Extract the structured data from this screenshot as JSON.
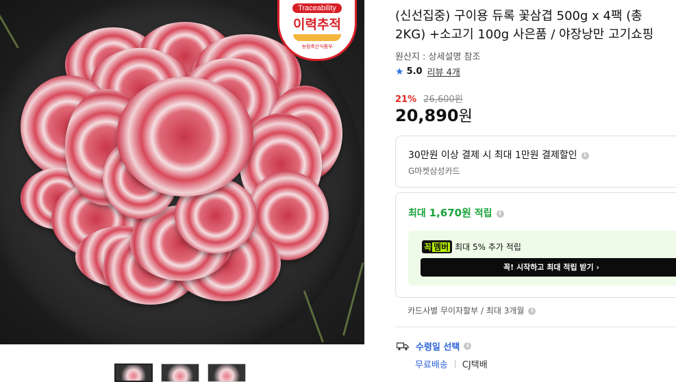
{
  "image": {
    "badge_top": "Traceability",
    "badge_main": "이력추적",
    "badge_bottom": "농림축산식품부"
  },
  "product": {
    "title": "(신선집중) 구이용 듀록 꽃삼겹 500g x 4팩 (총 2KG) +소고기 100g 사은품 / 야장낭만 고기쇼핑",
    "origin": "원산지 : 상세설명 참조",
    "rating": "5.0",
    "reviews": "리뷰 4개",
    "discount_rate": "21%",
    "original_price": "26,600원",
    "price_number": "20,890",
    "price_unit": "원"
  },
  "card_offer": {
    "title": "30만원 이상 결제 시 최대 1만원 결제할인",
    "card": "G마켓삼성카드"
  },
  "points": {
    "prefix": "최대",
    "amount": "1,670원",
    "suffix": "적립",
    "member_pill_a": "꼭",
    "member_pill_b": "멤버",
    "member_text": "최대 5% 추가 적립",
    "cta": "꼭! 시작하고 최대 적립 받기  ›"
  },
  "installment": "카드사별 무이자할부 / 최대 3개월",
  "shipping": {
    "select": "수령일 선택",
    "free": "무료배송",
    "carrier": "CJ택배"
  },
  "colors": {
    "accent_blue": "#2f62d6",
    "discount_red": "#e2271f",
    "point_green": "#1aa33a",
    "member_lime": "#b8f000"
  },
  "icons": [
    "star-icon",
    "info-icon",
    "truck-icon",
    "chevron-right-icon"
  ]
}
